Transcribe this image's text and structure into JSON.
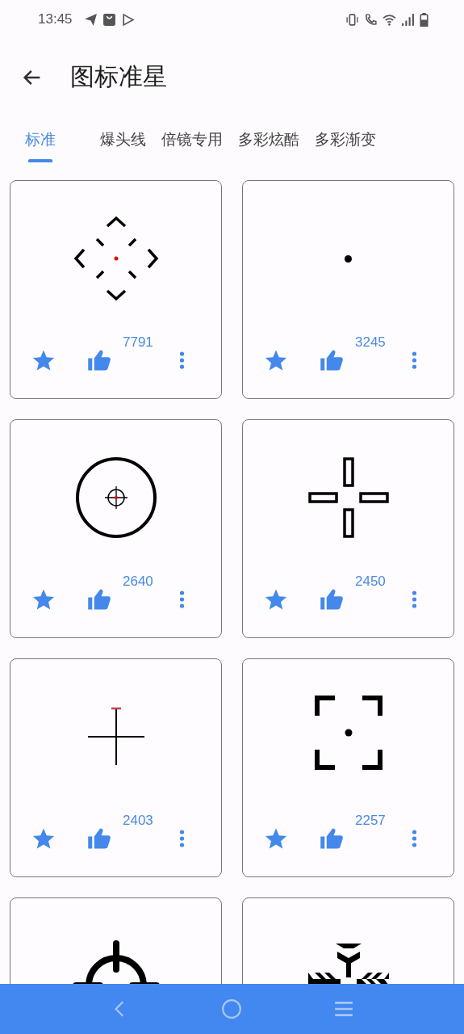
{
  "status_bar": {
    "time": "13:45"
  },
  "header": {
    "title": "图标准星"
  },
  "tabs": [
    {
      "label": "标准",
      "selected": true
    },
    {
      "label": "爆头线",
      "selected": false
    },
    {
      "label": "倍镜专用",
      "selected": false
    },
    {
      "label": "多彩炫酷",
      "selected": false
    },
    {
      "label": "多彩渐变",
      "selected": false
    }
  ],
  "cards": [
    {
      "kind": "diamond",
      "likes": "7791"
    },
    {
      "kind": "dot",
      "likes": "3245"
    },
    {
      "kind": "circle",
      "likes": "2640"
    },
    {
      "kind": "bars",
      "likes": "2450"
    },
    {
      "kind": "cross",
      "likes": "2403"
    },
    {
      "kind": "corners",
      "likes": "2257"
    },
    {
      "kind": "target"
    },
    {
      "kind": "snowflake"
    }
  ]
}
